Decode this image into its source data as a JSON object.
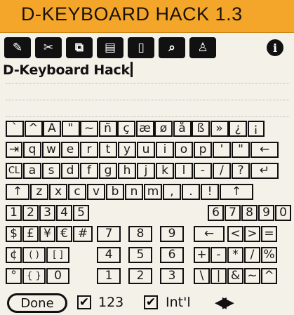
{
  "app": {
    "title": "D-KEYBOARD HACK 1.3"
  },
  "toolbar": {
    "buttons": [
      {
        "icon": "pencil-icon",
        "glyph": "✎"
      },
      {
        "icon": "scissors-icon",
        "glyph": "✂"
      },
      {
        "icon": "copy-icon",
        "glyph": "⧉"
      },
      {
        "icon": "paste-icon",
        "glyph": "▤"
      },
      {
        "icon": "page-icon",
        "glyph": "▯"
      },
      {
        "icon": "find-icon",
        "glyph": "⌕"
      },
      {
        "icon": "person-icon",
        "glyph": "♙"
      }
    ],
    "info_glyph": "i"
  },
  "text_area": {
    "value": "D-Keyboard Hack"
  },
  "keyboard": {
    "row1": [
      "`",
      "^",
      "A",
      "\"",
      "~",
      "ñ",
      "ç",
      "æ",
      "ø",
      "å",
      "ß",
      "»",
      "¿",
      "¡"
    ],
    "row2": [
      "⇥",
      "q",
      "w",
      "e",
      "r",
      "t",
      "y",
      "u",
      "i",
      "o",
      "p",
      "'",
      "\"",
      "←"
    ],
    "row3": [
      "CL",
      "a",
      "s",
      "d",
      "f",
      "g",
      "h",
      "j",
      "k",
      "l",
      "-",
      "/",
      "?",
      "↵"
    ],
    "row4": [
      "↑",
      "z",
      "x",
      "c",
      "v",
      "b",
      "n",
      "m",
      ",",
      ".",
      "!",
      "↑"
    ],
    "row5_left": [
      "1",
      "2",
      "3",
      "4",
      "5"
    ],
    "row5_right": [
      "6",
      "7",
      "8",
      "9",
      "0"
    ],
    "row6": [
      "$",
      "£",
      "¥",
      "€",
      "#",
      "7",
      "8",
      "9",
      "←",
      "<",
      ">",
      "="
    ],
    "row7": [
      "¢",
      "( )",
      "[ ]",
      "4",
      "5",
      "6",
      "+",
      "-",
      "*",
      "/",
      "%"
    ],
    "row8": [
      "°",
      "{ }",
      "0",
      "1",
      "2",
      "3",
      "\\",
      "|",
      "&",
      "~",
      "^"
    ]
  },
  "bottombar": {
    "done_label": "Done",
    "checkbox_123": {
      "label": "123",
      "checked": true
    },
    "checkbox_intl": {
      "label": "Int'l",
      "checked": true
    },
    "check_glyph": "✔",
    "arrows_glyph": "◀▶"
  },
  "colors": {
    "title_bar": "#f4a62a",
    "background": "#f4f1e9",
    "ink": "#111111"
  }
}
